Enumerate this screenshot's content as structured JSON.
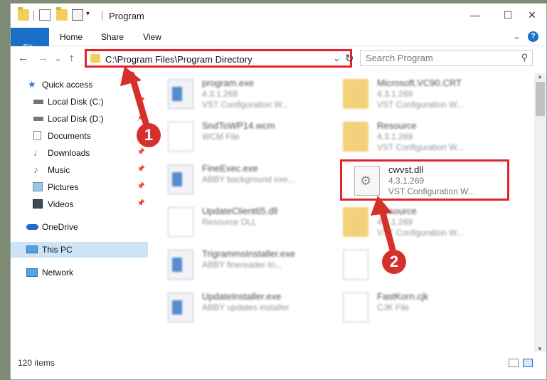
{
  "window": {
    "title": "Program",
    "minimize": "—",
    "maximize": "☐",
    "close": "✕"
  },
  "ribbon": {
    "tabs": [
      "File",
      "Home",
      "Share",
      "View"
    ],
    "expand": "⌄",
    "help": "?"
  },
  "nav": {
    "back": "←",
    "forward": "→",
    "recent": "⌄",
    "up": "↑",
    "address": "C:\\Program Files\\Program Directory",
    "address_dropdown": "⌄",
    "refresh": "↻",
    "search_placeholder": "Search Program",
    "search_icon": "⚲"
  },
  "sidebar": {
    "items": [
      {
        "label": "Quick access",
        "icon": "star-icon"
      },
      {
        "label": "Local Disk (C:)",
        "icon": "disk-icon"
      },
      {
        "label": "Local Disk (D:)",
        "icon": "disk-icon"
      },
      {
        "label": "Documents",
        "icon": "documents-icon"
      },
      {
        "label": "Downloads",
        "icon": "download-icon"
      },
      {
        "label": "Music",
        "icon": "music-icon"
      },
      {
        "label": "Pictures",
        "icon": "pictures-icon"
      },
      {
        "label": "Videos",
        "icon": "videos-icon"
      },
      {
        "label": "OneDrive",
        "icon": "cloud-icon"
      },
      {
        "label": "This PC",
        "icon": "computer-icon"
      },
      {
        "label": "Network",
        "icon": "network-icon"
      }
    ],
    "pin": "📌"
  },
  "files": [
    {
      "name": "program.exe",
      "d1": "4.3.1.269",
      "d2": "VST Configuration W..."
    },
    {
      "name": "Microsoft.VC90.CRT",
      "d1": "4.3.1.269",
      "d2": "VST Configuration W..."
    },
    {
      "name": "SndToWP14.wcm",
      "d1": "WCM File",
      "d2": ""
    },
    {
      "name": "Resource",
      "d1": "4.3.1.269",
      "d2": "VST Configuration W..."
    },
    {
      "name": "FineExec.exe",
      "d1": "ABBY background exe...",
      "d2": ""
    },
    {
      "name": "cwvst.dll",
      "d1": "4.3.1.269",
      "d2": "VST Configuration W..."
    },
    {
      "name": "UpdateClient65.dll",
      "d1": "Resource DLL",
      "d2": ""
    },
    {
      "name": "Resource",
      "d1": "4.3.1.269",
      "d2": "VST Configuration W..."
    },
    {
      "name": "TrigrammsInstaller.exe",
      "d1": "ABBY finereader tri...",
      "d2": ""
    },
    {
      "name": "",
      "d1": "",
      "d2": ""
    },
    {
      "name": "UpdateInstaller.exe",
      "d1": "ABBY updates installer",
      "d2": ""
    },
    {
      "name": "FastKorn.cjk",
      "d1": "CJK File",
      "d2": ""
    }
  ],
  "status": {
    "count": "120 items"
  },
  "badges": {
    "one": "1",
    "two": "2"
  },
  "colors": {
    "accent": "#1a6fc7",
    "highlight": "#e2242a",
    "badge": "#d4312c",
    "selected": "#cde4f7"
  }
}
